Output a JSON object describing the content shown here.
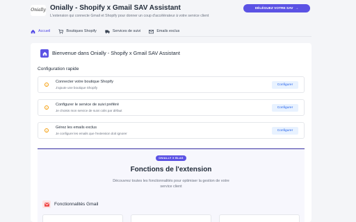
{
  "header": {
    "logo_text": "Onially",
    "title": "Onially - Shopify x Gmail SAV Assistant",
    "subtitle": "L'extension qui connecte Gmail et Shopify pour donner un coup d'accélérateur à votre service client",
    "cta_label": "DÉLÉGUEZ VOTRE SAV"
  },
  "tabs": [
    {
      "label": "Accueil",
      "icon": "home-icon",
      "active": true
    },
    {
      "label": "Boutiques Shopify",
      "icon": "cart-icon",
      "active": false
    },
    {
      "label": "Services de suivi",
      "icon": "truck-icon",
      "active": false
    },
    {
      "label": "Emails exclus",
      "icon": "mail-icon",
      "active": false
    }
  ],
  "welcome": {
    "icon": "home-icon",
    "title": "Bienvenue dans Onially - Shopify x Gmail SAV Assistant"
  },
  "config": {
    "title": "Configuration rapide",
    "items": [
      {
        "title": "Connecter votre boutique Shopify",
        "desc": "J'ajoute une boutique Shopify",
        "button": "Configurer",
        "icon": "warning-icon"
      },
      {
        "title": "Configurer le service de suivi préféré",
        "desc": "Je choisis mon service de suivi colis par défaut",
        "button": "Configurer",
        "icon": "warning-icon"
      },
      {
        "title": "Gérez les emails exclus",
        "desc": "Je configure les emails que l'extension doit ignorer",
        "button": "Configurer",
        "icon": "warning-icon"
      }
    ]
  },
  "features": {
    "badge": "ONIALLY X BLAS",
    "title": "Fonctions de l'extension",
    "description": "Découvrez toutes les fonctionnalités pour optimiser la gestion de votre service client",
    "section": {
      "label": "Fonctionnalités Gmail",
      "icon": "mail-icon"
    }
  },
  "colors": {
    "accent": "#5b52e4",
    "link": "#2563eb",
    "warning": "#f59e0b",
    "page_bg": "#f4f5f8"
  }
}
